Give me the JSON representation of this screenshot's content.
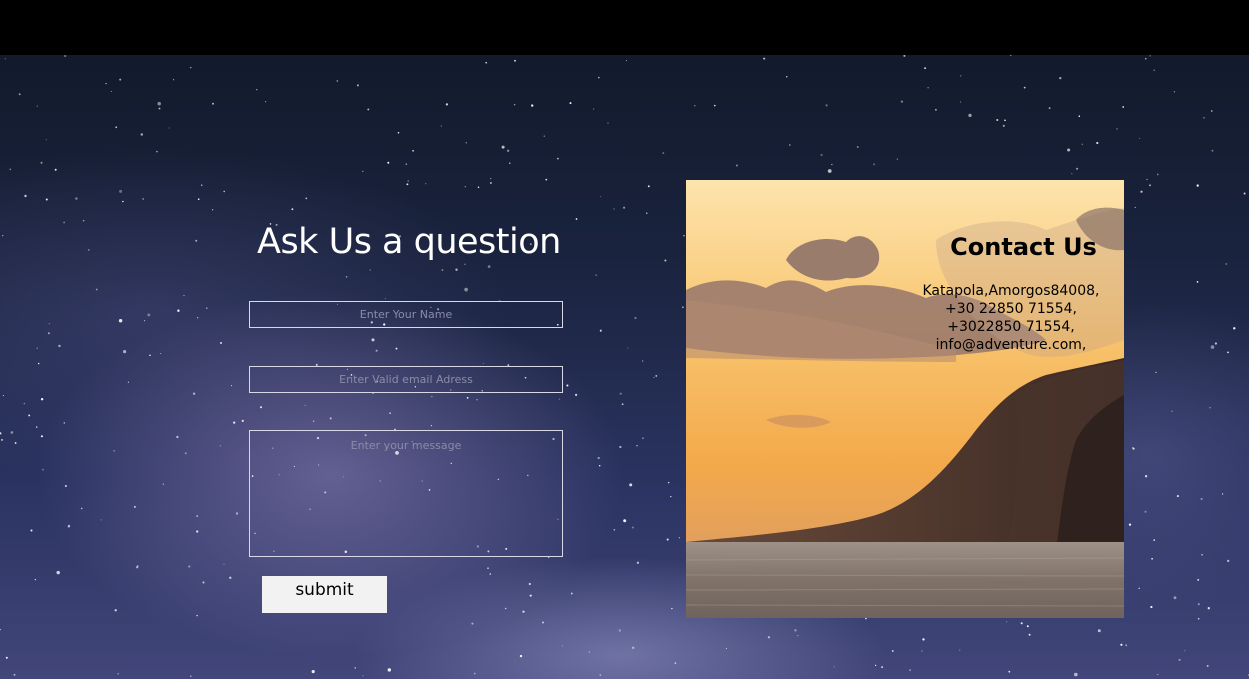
{
  "form": {
    "title": "Ask Us a question",
    "name_placeholder": "Enter Your Name",
    "email_placeholder": "Enter Valid email Adress",
    "message_placeholder": "Enter your message",
    "submit_label": "submit"
  },
  "contact": {
    "title": "Contact Us",
    "address": "Katapola,Amorgos84008,",
    "phone_1": "+30 22850 71554,",
    "phone_2": "+3022850 71554,",
    "email": "info@adventure.com,"
  },
  "colors": {
    "top_bar": "#000000",
    "night_sky": "#1b2440",
    "sunset_sky": "#f7b85a",
    "submit_background": "#f2f2f2"
  }
}
